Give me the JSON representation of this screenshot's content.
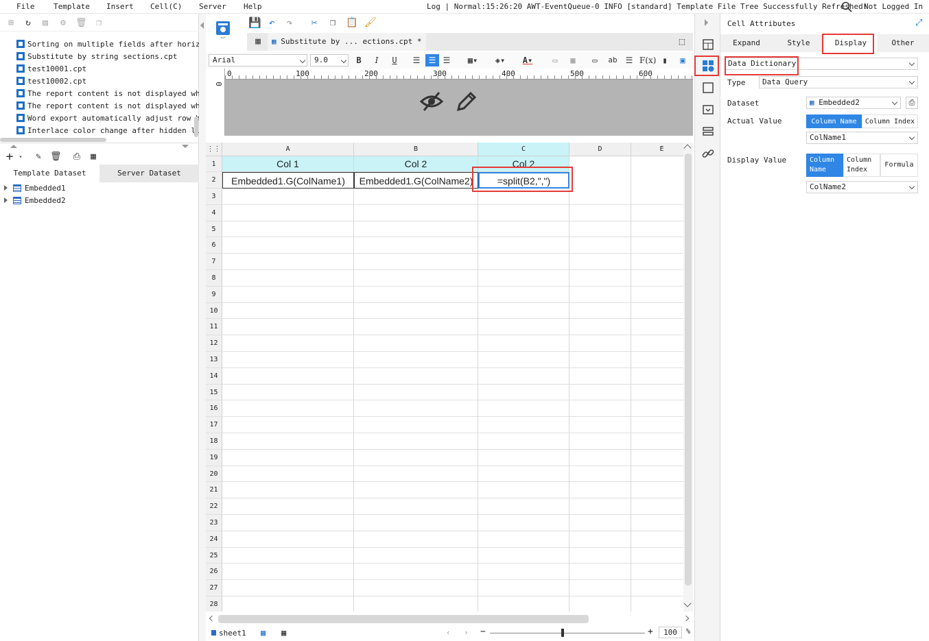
{
  "menu": {
    "items": [
      "File",
      "Template",
      "Insert",
      "Cell(C)",
      "Server",
      "Help"
    ],
    "status": "Log | Normal:15:26:20 AWT-EventQueue-0 INFO [standard] Template File Tree Successfully Refreshed!",
    "login": "Not Logged In"
  },
  "file_tree": {
    "items": [
      "Sorting on multiple fields after horizon",
      "Substitute by string sections.cpt",
      "test10001.cpt",
      "test10002.cpt",
      "The report content is not displayed when",
      "The report content is not displayed when",
      "Word export automatically adjust row hei",
      "Interlace color change after hidden line"
    ]
  },
  "datasets": {
    "tabs": [
      "Template Dataset",
      "Server Dataset"
    ],
    "items": [
      "Embedded1",
      "Embedded2"
    ]
  },
  "editor": {
    "tab_title": "Substitute by ... ections.cpt *",
    "font": "Arial",
    "font_size": "9.0",
    "ruler_ticks": [
      "0",
      "100",
      "200",
      "300",
      "400",
      "500",
      "600"
    ],
    "ruler_left": "0"
  },
  "sheet": {
    "columns": [
      "A",
      "B",
      "C",
      "D",
      "E"
    ],
    "rows": [
      "1",
      "2",
      "3",
      "4",
      "5",
      "6",
      "7",
      "8",
      "9",
      "10",
      "11",
      "12",
      "13",
      "14",
      "15",
      "16",
      "17",
      "18",
      "19",
      "20",
      "21",
      "22",
      "23",
      "24",
      "25",
      "26",
      "27",
      "28"
    ],
    "row1": [
      "Col 1",
      "Col 2",
      "Col 2"
    ],
    "row2": [
      "Embedded1.G(ColName1)",
      "Embedded1.G(ColName2)",
      "=split(B2,\",\")"
    ]
  },
  "bottom": {
    "sheet_tab": "sheet1",
    "zoom": "100",
    "zoom_unit": "%",
    "zoom_minus": "−",
    "zoom_plus": "+"
  },
  "cell_attributes": {
    "title": "Cell Attributes",
    "tabs": [
      "Expand",
      "Style",
      "Display",
      "Other"
    ],
    "active_tab": "Display",
    "format": "Data Dictionary",
    "type_label": "Type",
    "type_value": "Data Query",
    "dataset_label": "Dataset",
    "dataset_value": "Embedded2",
    "actual_label": "Actual Value",
    "actual_options": [
      "Column Name",
      "Column Index"
    ],
    "actual_column": "ColName1",
    "display_label": "Display Value",
    "display_options": [
      "Column Name",
      "Column Index",
      "Formula"
    ],
    "display_column": "ColName2"
  },
  "colors": {
    "accent": "#2f86e5",
    "highlight": "#e53935",
    "header_cyan": "#c9f3f7"
  }
}
